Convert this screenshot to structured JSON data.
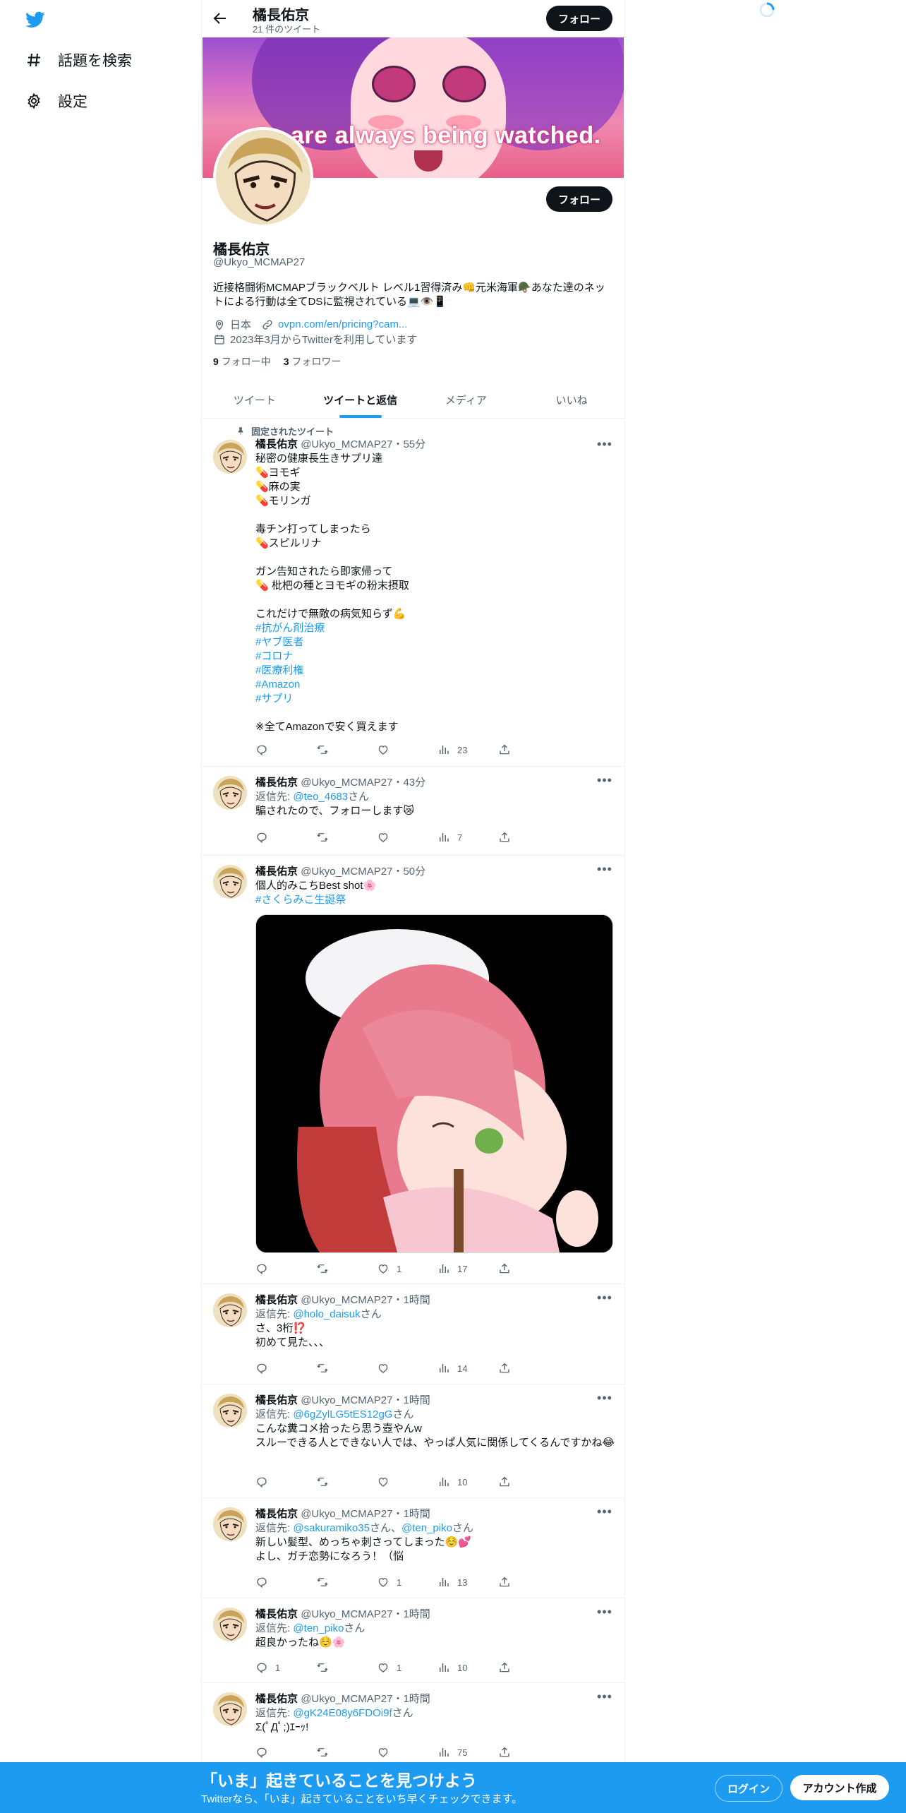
{
  "nav": {
    "logo": "twitter-bird-icon",
    "explore_label": "話題を検索",
    "settings_label": "設定"
  },
  "header": {
    "name": "橘長佑京",
    "tweet_count": "21 件のツイート",
    "follow_label": "フォロー"
  },
  "banner": {
    "text": "are always being watched."
  },
  "profile": {
    "name": "橘長佑京",
    "handle": "@Ukyo_MCMAP27",
    "bio": "近接格闘術MCMAPブラックベルト レベル1習得済み👊元米海軍🪖あなた達のネットによる行動は全てDSに監視されている💻👁️📱",
    "location": "日本",
    "link": "ovpn.com/en/pricing?cam...",
    "joined": "2023年3月からTwitterを利用しています",
    "following_count": "9",
    "following_label": "フォロー中",
    "followers_count": "3",
    "followers_label": "フォロワー",
    "follow_label": "フォロー"
  },
  "tabs": [
    {
      "label": "ツイート"
    },
    {
      "label": "ツイートと返信"
    },
    {
      "label": "メディア"
    },
    {
      "label": "いいね"
    }
  ],
  "pinned_label": "固定されたツイート",
  "tweets": [
    {
      "name": "橘長佑京",
      "meta": "@Ukyo_MCMAP27・55分",
      "text": "秘密の健康長生きサプリ達\n💊ヨモギ\n💊麻の実\n💊モリンガ\n\n毒チン打ってしまったら\n💊スピルリナ\n\nガン告知されたら即家帰って\n💊 枇杷の種とヨモギの粉末摂取\n\nこれだけで無敵の病気知らず💪",
      "hashtags": [
        "#抗がん剤治療",
        "#ヤブ医者",
        "#コロナ",
        "#医療利権",
        "#Amazon",
        "#サプリ"
      ],
      "tail": "※全てAmazonで安く買えます",
      "views": "23"
    },
    {
      "name": "橘長佑京",
      "meta": "@Ukyo_MCMAP27・43分",
      "reply_prefix": "返信先: ",
      "reply_to": "@teo_4683",
      "reply_suffix": "さん",
      "text": "騙されたので、フォローします😿",
      "views": "7"
    },
    {
      "name": "橘長佑京",
      "meta": "@Ukyo_MCMAP27・50分",
      "text": "個人的みこちBest shot🌸",
      "hashtag": "#さくらみこ生誕祭",
      "likes": "1",
      "views": "17"
    },
    {
      "name": "橘長佑京",
      "meta": "@Ukyo_MCMAP27・1時間",
      "reply_prefix": "返信先: ",
      "reply_to": "@holo_daisuk",
      "reply_suffix": "さん",
      "text": "さ、3桁⁉️\n初めて見た、、、",
      "views": "14"
    },
    {
      "name": "橘長佑京",
      "meta": "@Ukyo_MCMAP27・1時間",
      "reply_prefix": "返信先: ",
      "reply_to": "@6gZylLG5tES12gG",
      "reply_suffix": "さん",
      "text": "こんな糞コメ拾ったら思う壺やんw\nスルーできる人とできない人では、やっぱ人気に関係してくるんですかね😂",
      "views": "10"
    },
    {
      "name": "橘長佑京",
      "meta": "@Ukyo_MCMAP27・1時間",
      "reply_prefix": "返信先: ",
      "reply_to": "@sakuramiko35",
      "reply_mid": "さん、",
      "reply_to2": "@ten_piko",
      "reply_suffix": "さん",
      "text": "新しい髪型、めっちゃ刺さってしまった☺️💕\nよし、ガチ恋勢になろう！（悩",
      "likes": "1",
      "views": "13"
    },
    {
      "name": "橘長佑京",
      "meta": "@Ukyo_MCMAP27・1時間",
      "reply_prefix": "返信先: ",
      "reply_to": "@ten_piko",
      "reply_suffix": "さん",
      "text": "超良かったね☺️🌸",
      "replies": "1",
      "likes": "1",
      "views": "10"
    },
    {
      "name": "橘長佑京",
      "meta": "@Ukyo_MCMAP27・1時間",
      "reply_prefix": "返信先: ",
      "reply_to": "@gK24E08y6FDOi9f",
      "reply_suffix": "さん",
      "text": "Σ(ﾟДﾟ;)ｴｰｯ!",
      "views": "75"
    }
  ],
  "bottom_bar": {
    "title": "「いま」起きていることを見つけよう",
    "subtitle": "Twitterなら、「いま」起きていることをいち早くチェックできます。",
    "login_label": "ログイン",
    "signup_label": "アカウント作成"
  },
  "colors": {
    "accent": "#1d9bf0",
    "text": "#0f1419",
    "muted": "#536471"
  }
}
